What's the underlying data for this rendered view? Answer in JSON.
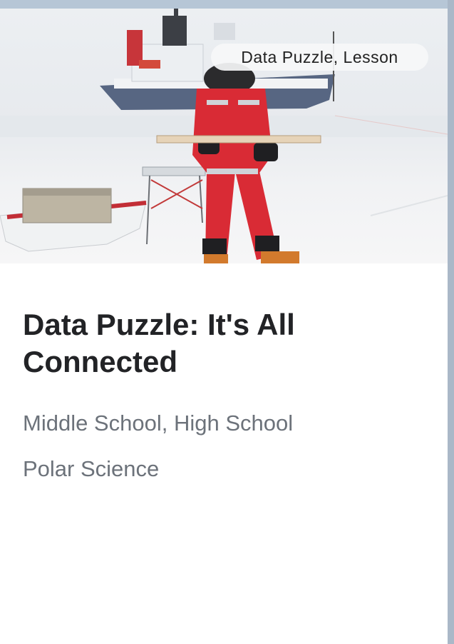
{
  "card": {
    "tag": "Data Puzzle, Lesson",
    "title": "Data Puzzle: It's All Connected",
    "levels": "Middle School, High School",
    "subject": "Polar Science"
  },
  "icons": [
    "photo"
  ],
  "colors": {
    "title": "#222326",
    "meta": "#6c727a",
    "suit_red": "#d92b35",
    "frame": "#a9b9c9"
  }
}
